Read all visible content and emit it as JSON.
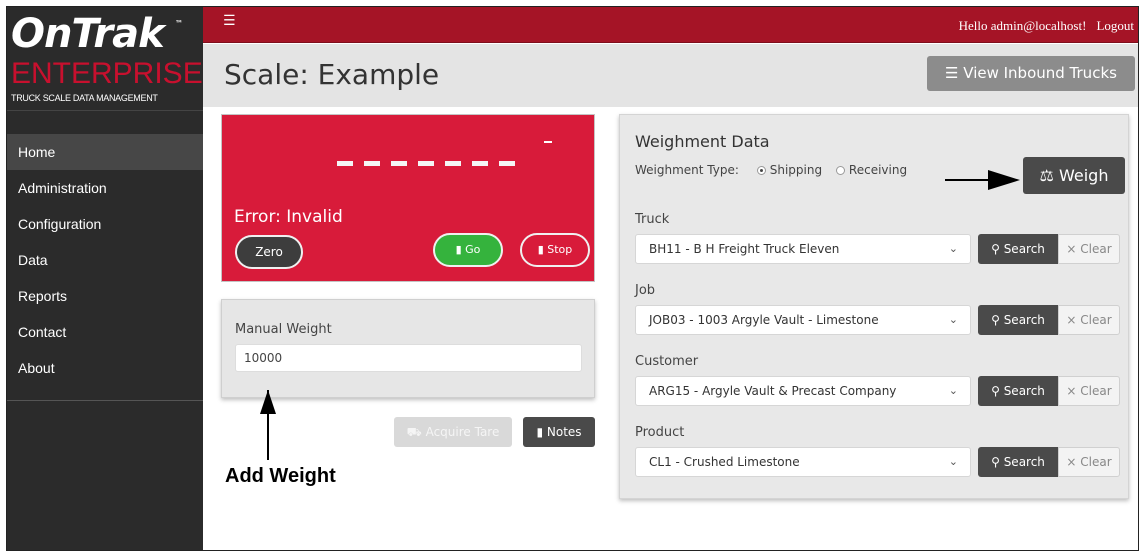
{
  "brand": {
    "logo_main": "OnTrak",
    "logo_tm": "™",
    "logo_enterprise": "ENTERPRISE",
    "logo_subtitle": "TRUCK SCALE DATA MANAGEMENT"
  },
  "sidebar": {
    "items": [
      {
        "label": "Home",
        "active": true
      },
      {
        "label": "Administration"
      },
      {
        "label": "Configuration"
      },
      {
        "label": "Data"
      },
      {
        "label": "Reports"
      },
      {
        "label": "Contact"
      },
      {
        "label": "About"
      }
    ]
  },
  "topbar": {
    "menu_icon": "hamburger-icon",
    "greeting": "Hello admin@localhost!",
    "logout": "Logout"
  },
  "header": {
    "title": "Scale: Example",
    "inbound_button": "View Inbound Trucks",
    "inbound_icon": "layers-icon"
  },
  "scale": {
    "readout": "- - - - - - -",
    "error": "Error: Invalid",
    "zero_label": "Zero",
    "go_label": "Go",
    "stop_label": "Stop",
    "color": "#d81b3a"
  },
  "manual": {
    "label": "Manual Weight",
    "value": "10000"
  },
  "actions": {
    "acquire_tare": "Acquire Tare",
    "notes": "Notes"
  },
  "annotations": {
    "add_weight": "Add Weight"
  },
  "weighment": {
    "title": "Weighment Data",
    "type_label": "Weighment Type:",
    "options": [
      {
        "label": "Shipping",
        "selected": true
      },
      {
        "label": "Receiving",
        "selected": false
      }
    ],
    "weigh_button": "Weigh",
    "weigh_icon": "scale-icon",
    "fields": [
      {
        "label": "Truck",
        "value": "BH11 - B H Freight Truck Eleven",
        "search": "Search",
        "clear": "Clear"
      },
      {
        "label": "Job",
        "value": "JOB03 - 1003 Argyle Vault - Limestone",
        "search": "Search",
        "clear": "Clear"
      },
      {
        "label": "Customer",
        "value": "ARG15 - Argyle Vault & Precast Company",
        "search": "Search",
        "clear": "Clear"
      },
      {
        "label": "Product",
        "value": "CL1 - Crushed Limestone",
        "search": "Search",
        "clear": "Clear"
      }
    ]
  }
}
